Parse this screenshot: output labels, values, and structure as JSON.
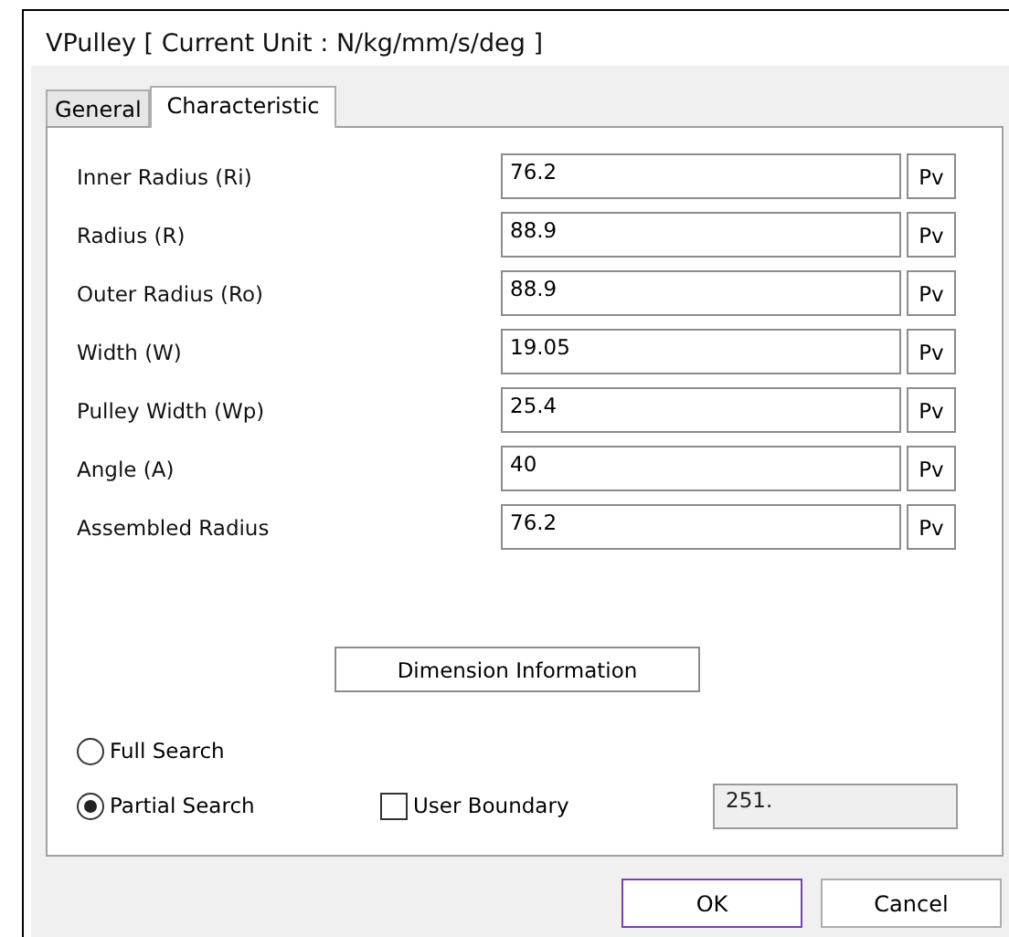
{
  "window": {
    "title": "VPulley [ Current Unit : N/kg/mm/s/deg ]"
  },
  "tabs": [
    {
      "label": "General",
      "selected": false
    },
    {
      "label": "Characteristic",
      "selected": true
    }
  ],
  "fields": [
    {
      "label": "Inner Radius (Ri)",
      "value": "76.2",
      "button": "Pv"
    },
    {
      "label": "Radius (R)",
      "value": "88.9",
      "button": "Pv"
    },
    {
      "label": "Outer Radius (Ro)",
      "value": "88.9",
      "button": "Pv"
    },
    {
      "label": "Width (W)",
      "value": "19.05",
      "button": "Pv"
    },
    {
      "label": "Pulley Width (Wp)",
      "value": "25.4",
      "button": "Pv"
    },
    {
      "label": "Angle (A)",
      "value": "40",
      "button": "Pv"
    },
    {
      "label": "Assembled Radius",
      "value": "76.2",
      "button": "Pv"
    }
  ],
  "dimension_button": "Dimension Information",
  "search_modes": [
    {
      "label": "Full Search",
      "selected": false
    },
    {
      "label": "Partial Search",
      "selected": true
    }
  ],
  "user_boundary": {
    "label": "User Boundary",
    "checked": false,
    "value": "251.",
    "disabled": true
  },
  "buttons": [
    {
      "label": "OK",
      "focused": true
    },
    {
      "label": "Cancel",
      "focused": false
    }
  ]
}
